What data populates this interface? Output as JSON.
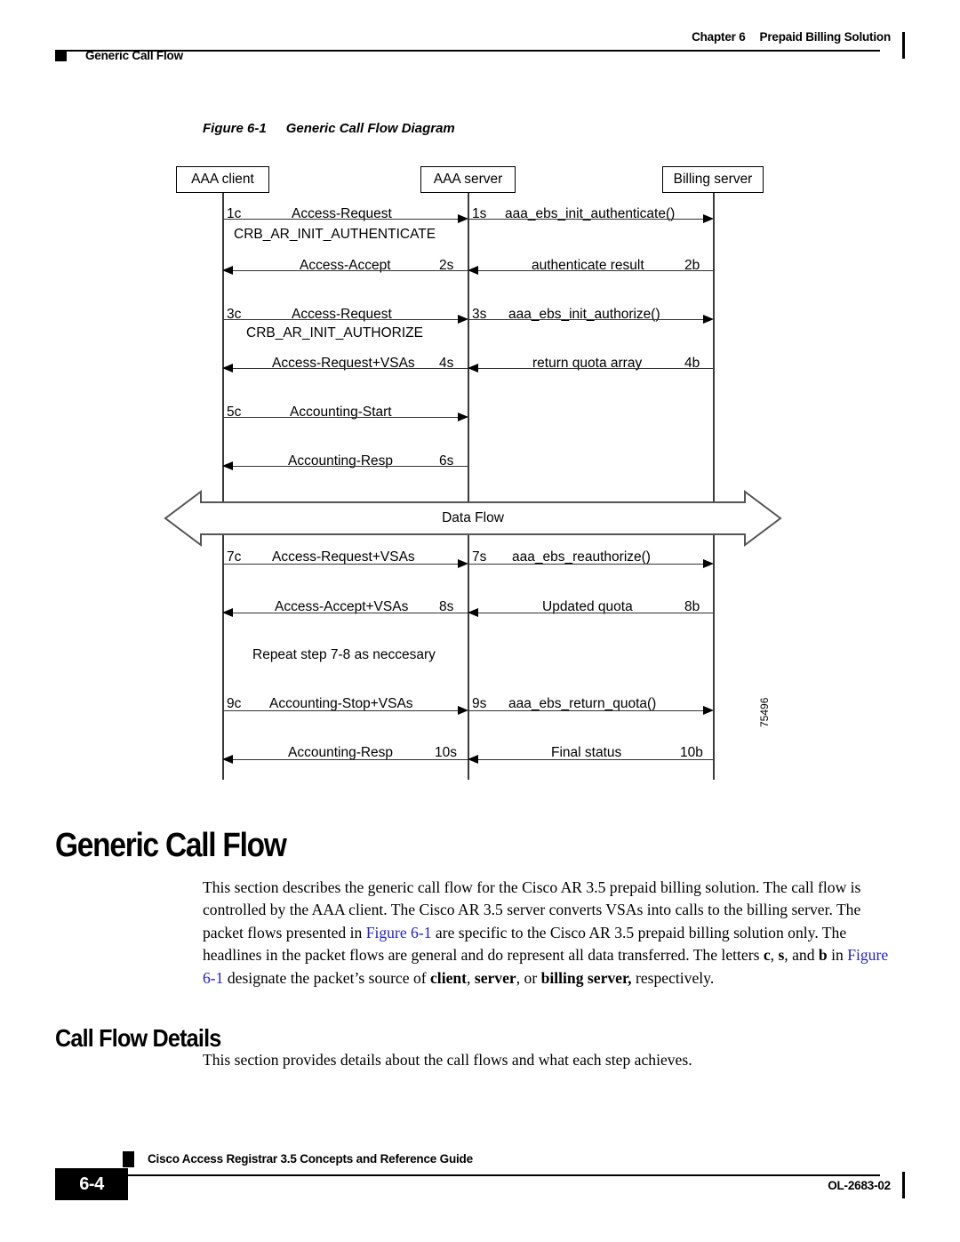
{
  "header": {
    "chapter": "Chapter 6",
    "chapter_title": "Prepaid Billing Solution",
    "running_head": "Generic Call Flow"
  },
  "figure": {
    "number": "Figure 6-1",
    "title": "Generic Call Flow Diagram",
    "figure_id": "75496",
    "nodes": [
      {
        "label": "AAA client"
      },
      {
        "label": "AAA server"
      },
      {
        "label": "Billing server"
      }
    ],
    "data_flow_label": "Data Flow",
    "repeat_note": "Repeat step 7-8 as neccesary",
    "notes": [
      {
        "label": "CRB_AR_INIT_AUTHENTICATE"
      },
      {
        "label": "CRB_AR_INIT_AUTHORIZE"
      }
    ],
    "messages": [
      {
        "step": "1c",
        "label": "Access-Request",
        "lane": "left",
        "dir": "right"
      },
      {
        "step": "1s",
        "label": "aaa_ebs_init_authenticate()",
        "lane": "right",
        "dir": "right"
      },
      {
        "step": "2s",
        "label": "Access-Accept",
        "lane": "left",
        "dir": "left"
      },
      {
        "step": "2b",
        "label": "authenticate result",
        "lane": "right",
        "dir": "left"
      },
      {
        "step": "3c",
        "label": "Access-Request",
        "lane": "left",
        "dir": "right"
      },
      {
        "step": "3s",
        "label": "aaa_ebs_init_authorize()",
        "lane": "right",
        "dir": "right"
      },
      {
        "step": "4s",
        "label": "Access-Request+VSAs",
        "lane": "left",
        "dir": "left"
      },
      {
        "step": "4b",
        "label": "return quota array",
        "lane": "right",
        "dir": "left"
      },
      {
        "step": "5c",
        "label": "Accounting-Start",
        "lane": "left",
        "dir": "right"
      },
      {
        "step": "6s",
        "label": "Accounting-Resp",
        "lane": "left",
        "dir": "left"
      },
      {
        "step": "7c",
        "label": "Access-Request+VSAs",
        "lane": "left",
        "dir": "right"
      },
      {
        "step": "7s",
        "label": "aaa_ebs_reauthorize()",
        "lane": "right",
        "dir": "right"
      },
      {
        "step": "8s",
        "label": "Access-Accept+VSAs",
        "lane": "left",
        "dir": "left"
      },
      {
        "step": "8b",
        "label": "Updated quota",
        "lane": "right",
        "dir": "left"
      },
      {
        "step": "9c",
        "label": "Accounting-Stop+VSAs",
        "lane": "left",
        "dir": "right"
      },
      {
        "step": "9s",
        "label": "aaa_ebs_return_quota()",
        "lane": "right",
        "dir": "right"
      },
      {
        "step": "10s",
        "label": "Accounting-Resp",
        "lane": "left",
        "dir": "left"
      },
      {
        "step": "10b",
        "label": "Final status",
        "lane": "right",
        "dir": "left"
      }
    ]
  },
  "sections": {
    "generic_call_flow_heading": "Generic Call Flow",
    "call_flow_details_heading": "Call Flow Details",
    "para1_a": "This section describes the generic call flow for the Cisco AR 3.5 prepaid billing solution. The call flow is controlled by the AAA client. The Cisco AR 3.5 server converts VSAs into calls to the billing server. The packet flows presented in ",
    "para1_link1": "Figure 6-1",
    "para1_b": " are specific to the Cisco AR 3.5 prepaid billing solution only. The headlines in the packet flows are general and do represent all data transferred. The letters ",
    "para1_c": "c",
    "para1_d": ", ",
    "para1_e": "s",
    "para1_f": ", and ",
    "para1_g": "b",
    "para1_h": " in ",
    "para1_link2": "Figure 6-1",
    "para1_i": " designate the packet’s source of ",
    "para1_j": "client",
    "para1_k": ", ",
    "para1_l": "server",
    "para1_m": ", or ",
    "para1_n": "billing server,",
    "para1_o": " respectively.",
    "para2": "This section provides details about the call flows and what each step achieves."
  },
  "footer": {
    "doc_title": "Cisco Access Registrar 3.5 Concepts and Reference Guide",
    "page_number": "6-4",
    "doc_id": "OL-2683-02"
  }
}
